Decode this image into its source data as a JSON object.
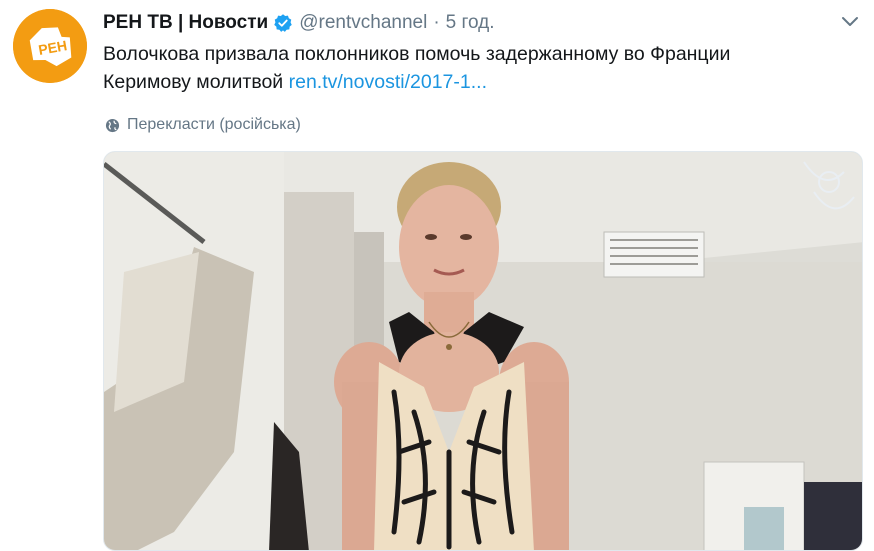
{
  "account": {
    "display_name": "РЕН ТВ | Новости",
    "handle": "@rentvchannel",
    "separator": "·",
    "time": "5 год.",
    "avatar_logo_text": "РЕН"
  },
  "tweet": {
    "text_line1": "Волочкова призвала поклонников помочь задержанному во Франции",
    "text_line2_prefix": "Керимову молитвой ",
    "link": "ren.tv/novosti/2017-1..."
  },
  "translate": {
    "label": "Перекласти (російська)"
  },
  "colors": {
    "accent": "#1b95e0",
    "avatar_bg": "#f39c12",
    "verified": "#1da1f2"
  },
  "icons": {
    "verified": "verified-badge-icon",
    "more": "chevron-down-icon",
    "translate": "globe-icon"
  }
}
